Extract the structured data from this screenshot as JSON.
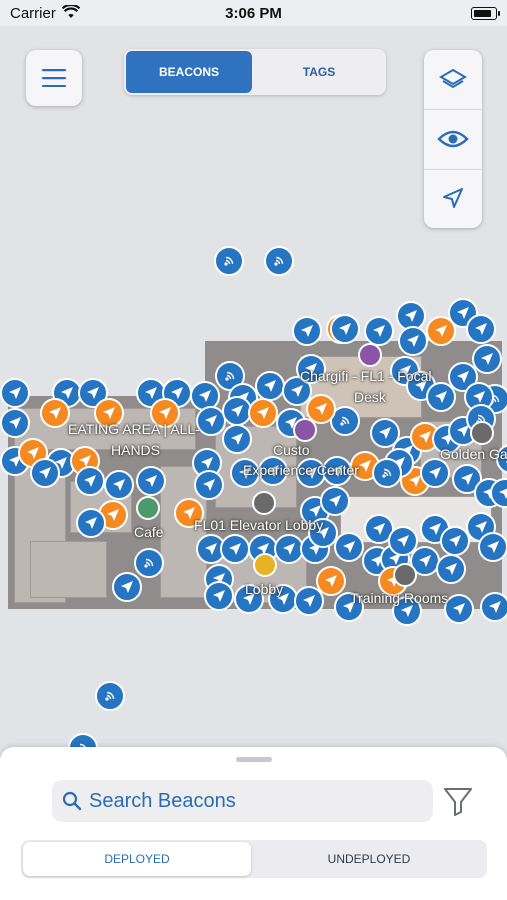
{
  "status_bar": {
    "carrier": "Carrier",
    "time": "3:06 PM"
  },
  "toolbar": {
    "menu_icon": "hamburger-menu-icon",
    "segment": {
      "beacons_label": "BEACONS",
      "tags_label": "TAGS",
      "selected": "BEACONS"
    },
    "map_controls": [
      "layers-icon",
      "eye-icon",
      "location-arrow-icon"
    ]
  },
  "map": {
    "labels": {
      "eating_area_line1": "EATING AREA | ALL-",
      "eating_area_line2": "HANDS",
      "cafe": "Cafe",
      "elevator_lobby": "FL01 Elevator Lobby",
      "lobby": "Lobby",
      "chargifi_line1": "Chargifi - FL1 - Focal",
      "chargifi_line2": "Desk",
      "customer_line1": "Custo",
      "customer_line2": "Experience Center",
      "golden_gate": "Golden Ga",
      "training_rooms": "Training Rooms"
    },
    "colors": {
      "beacon": "#2675c2",
      "orange_beacon": "#f6891f",
      "floor": "#8f8c8b"
    }
  },
  "bottom_sheet": {
    "search_placeholder": "Search Beacons",
    "filter_icon": "filter-funnel-icon",
    "tabs": {
      "deployed": "DEPLOYED",
      "undeployed": "UNDEPLOYED",
      "selected": "DEPLOYED"
    }
  }
}
